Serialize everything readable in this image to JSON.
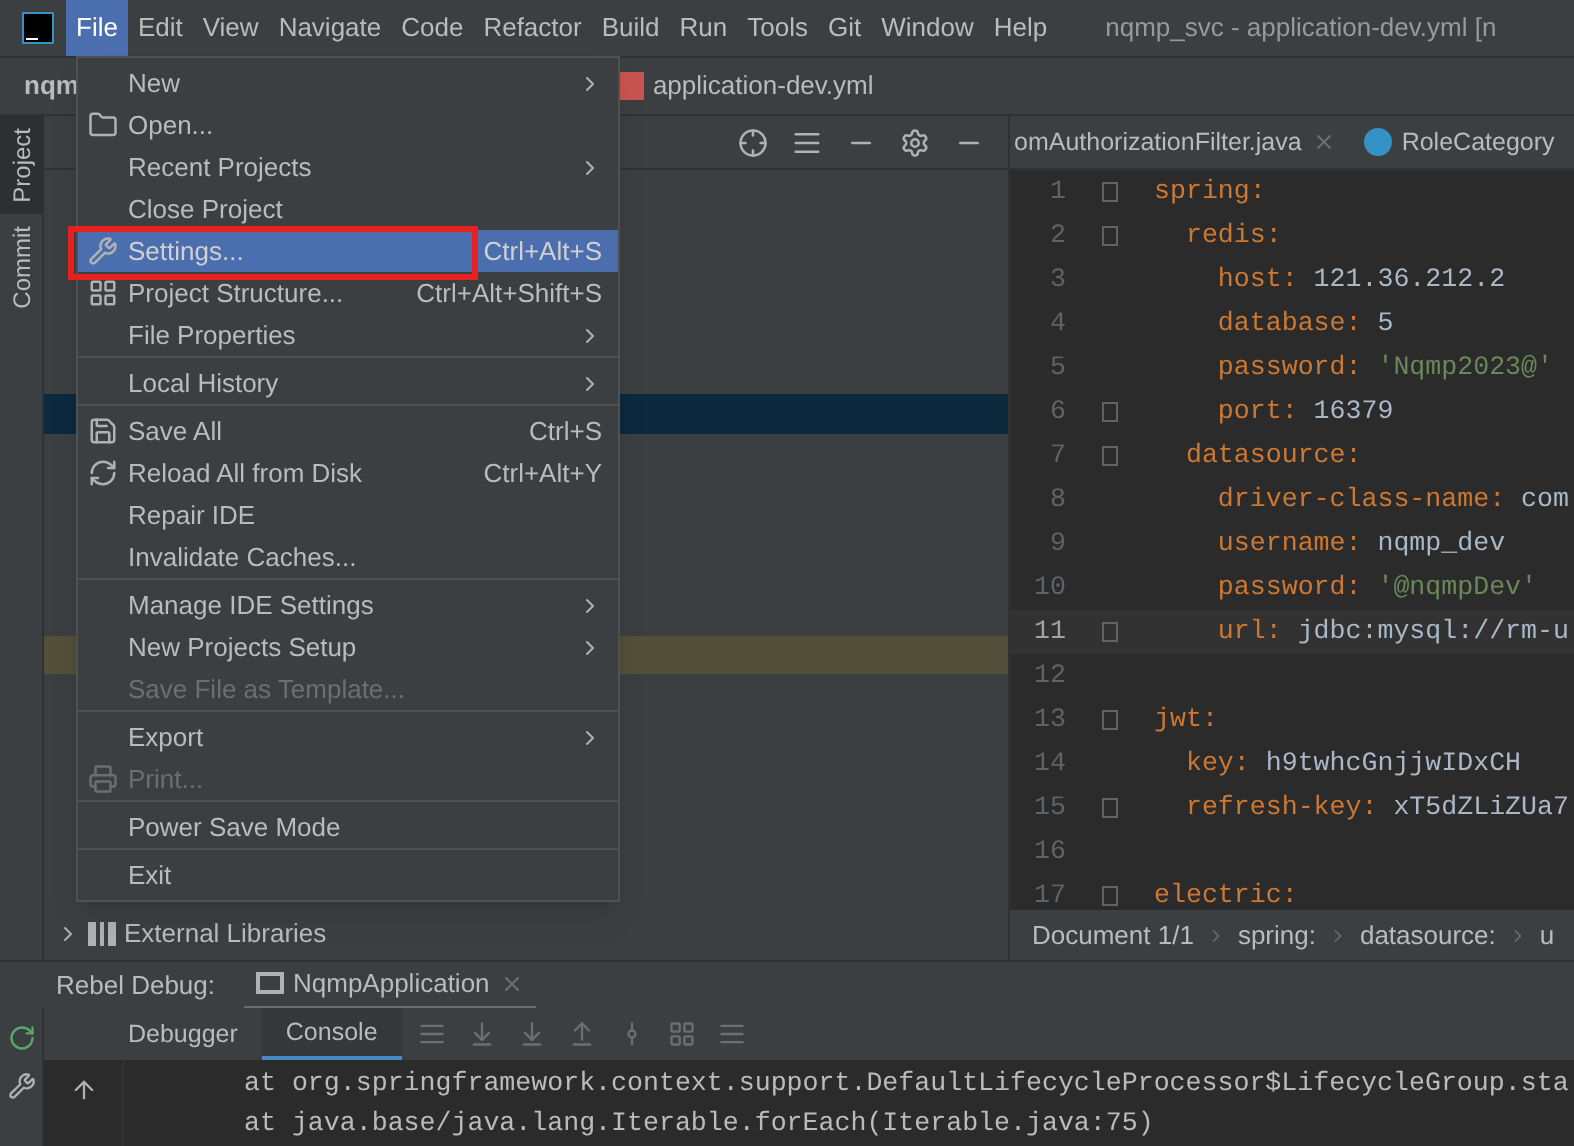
{
  "menu_bar": {
    "items": [
      {
        "label": "File",
        "selected": true
      },
      {
        "label": "Edit",
        "selected": false
      },
      {
        "label": "View",
        "selected": false
      },
      {
        "label": "Navigate",
        "selected": false
      },
      {
        "label": "Code",
        "selected": false
      },
      {
        "label": "Refactor",
        "selected": false
      },
      {
        "label": "Build",
        "selected": false
      },
      {
        "label": "Run",
        "selected": false
      },
      {
        "label": "Tools",
        "selected": false
      },
      {
        "label": "Git",
        "selected": false
      },
      {
        "label": "Window",
        "selected": false
      },
      {
        "label": "Help",
        "selected": false
      }
    ],
    "title": "nqmp_svc - application-dev.yml [n"
  },
  "navigation_bar": {
    "project": "nqm",
    "file": "application-dev.yml"
  },
  "tool_strip": [
    {
      "label": "Project",
      "selected": true
    },
    {
      "label": "Commit",
      "selected": false
    }
  ],
  "project_tree": {
    "items": [
      {
        "label": "External Libraries",
        "expanded": false
      }
    ]
  },
  "editor": {
    "tabs": [
      {
        "label": "omAuthorizationFilter.java",
        "selected": false,
        "closable": true
      },
      {
        "label": "RoleCategory",
        "selected": false,
        "closable": false
      }
    ],
    "lines": [
      {
        "number": "1",
        "key": "spring:",
        "kind": "plain",
        "fold": true,
        "current": false
      },
      {
        "number": "2",
        "key": "  redis:",
        "kind": "plain",
        "fold": true,
        "current": false
      },
      {
        "number": "3",
        "key": "    host:",
        "value": "121.36.212.2",
        "kind": "plain",
        "fold": false,
        "current": false
      },
      {
        "number": "4",
        "key": "    database:",
        "value": "5",
        "kind": "plain",
        "fold": false,
        "current": false
      },
      {
        "number": "5",
        "key": "    password:",
        "value": "'Nqmp2023@'",
        "kind": "string",
        "fold": false,
        "current": false
      },
      {
        "number": "6",
        "key": "    port:",
        "value": "16379",
        "kind": "plain",
        "fold": true,
        "current": false
      },
      {
        "number": "7",
        "key": "  datasource:",
        "kind": "plain",
        "fold": true,
        "current": false
      },
      {
        "number": "8",
        "key": "    driver-class-name:",
        "value": "com",
        "kind": "plain",
        "fold": false,
        "current": false
      },
      {
        "number": "9",
        "key": "    username:",
        "value": "nqmp_dev",
        "kind": "plain",
        "fold": false,
        "current": false
      },
      {
        "number": "10",
        "key": "    password:",
        "value": "'@nqmpDev'",
        "kind": "string",
        "fold": false,
        "current": false
      },
      {
        "number": "11",
        "key": "    url:",
        "value": "jdbc:mysql://rm-u",
        "kind": "plain",
        "fold": true,
        "current": true
      },
      {
        "number": "12",
        "kind": "blank",
        "fold": false,
        "current": false
      },
      {
        "number": "13",
        "key": "jwt:",
        "kind": "plain",
        "fold": true,
        "current": false
      },
      {
        "number": "14",
        "key": "  key:",
        "value": "h9twhcGnjjwIDxCH",
        "kind": "plain",
        "fold": false,
        "current": false
      },
      {
        "number": "15",
        "key": "  refresh-key:",
        "value": "xT5dZLiZUa7",
        "kind": "plain",
        "fold": true,
        "current": false
      },
      {
        "number": "16",
        "kind": "blank",
        "fold": false,
        "current": false
      },
      {
        "number": "17",
        "key": "electric:",
        "kind": "plain",
        "fold": true,
        "current": false
      }
    ],
    "breadcrumbs": [
      "Document 1/1",
      "spring:",
      "datasource:",
      "u"
    ]
  },
  "file_menu": {
    "items": [
      {
        "label": "New",
        "submenu": true,
        "disabled": false,
        "selected": false,
        "separator_after": false
      },
      {
        "label": "Open...",
        "submenu": false,
        "disabled": false,
        "selected": false,
        "separator_after": false
      },
      {
        "label": "Recent Projects",
        "submenu": true,
        "disabled": false,
        "selected": false,
        "separator_after": false
      },
      {
        "label": "Close Project",
        "submenu": false,
        "disabled": false,
        "selected": false,
        "separator_after": false
      },
      {
        "label": "Settings...",
        "shortcut": "Ctrl+Alt+S",
        "submenu": false,
        "disabled": false,
        "selected": true,
        "separator_after": false
      },
      {
        "label": "Project Structure...",
        "shortcut": "Ctrl+Alt+Shift+S",
        "submenu": false,
        "disabled": false,
        "selected": false,
        "separator_after": false
      },
      {
        "label": "File Properties",
        "submenu": true,
        "disabled": false,
        "selected": false,
        "separator_after": true
      },
      {
        "label": "Local History",
        "submenu": true,
        "disabled": false,
        "selected": false,
        "separator_after": true
      },
      {
        "label": "Save All",
        "shortcut": "Ctrl+S",
        "submenu": false,
        "disabled": false,
        "selected": false,
        "separator_after": false
      },
      {
        "label": "Reload All from Disk",
        "shortcut": "Ctrl+Alt+Y",
        "submenu": false,
        "disabled": false,
        "selected": false,
        "separator_after": false
      },
      {
        "label": "Repair IDE",
        "submenu": false,
        "disabled": false,
        "selected": false,
        "separator_after": false
      },
      {
        "label": "Invalidate Caches...",
        "submenu": false,
        "disabled": false,
        "selected": false,
        "separator_after": true
      },
      {
        "label": "Manage IDE Settings",
        "submenu": true,
        "disabled": false,
        "selected": false,
        "separator_after": false
      },
      {
        "label": "New Projects Setup",
        "submenu": true,
        "disabled": false,
        "selected": false,
        "separator_after": false
      },
      {
        "label": "Save File as Template...",
        "submenu": false,
        "disabled": true,
        "selected": false,
        "separator_after": true
      },
      {
        "label": "Export",
        "submenu": true,
        "disabled": false,
        "selected": false,
        "separator_after": false
      },
      {
        "label": "Print...",
        "submenu": false,
        "disabled": true,
        "selected": false,
        "separator_after": true
      },
      {
        "label": "Power Save Mode",
        "submenu": false,
        "disabled": false,
        "selected": false,
        "separator_after": true
      },
      {
        "label": "Exit",
        "submenu": false,
        "disabled": false,
        "selected": false,
        "separator_after": false
      }
    ]
  },
  "debug": {
    "title": "Rebel Debug:",
    "session": "NqmpApplication",
    "tabs": [
      {
        "label": "Debugger",
        "selected": false
      },
      {
        "label": "Console",
        "selected": true
      }
    ],
    "console_lines": [
      "at org.springframework.context.support.DefaultLifecycleProcessor$LifecycleGroup.sta",
      "at java.base/java.lang.Iterable.forEach(Iterable.java:75)"
    ]
  }
}
